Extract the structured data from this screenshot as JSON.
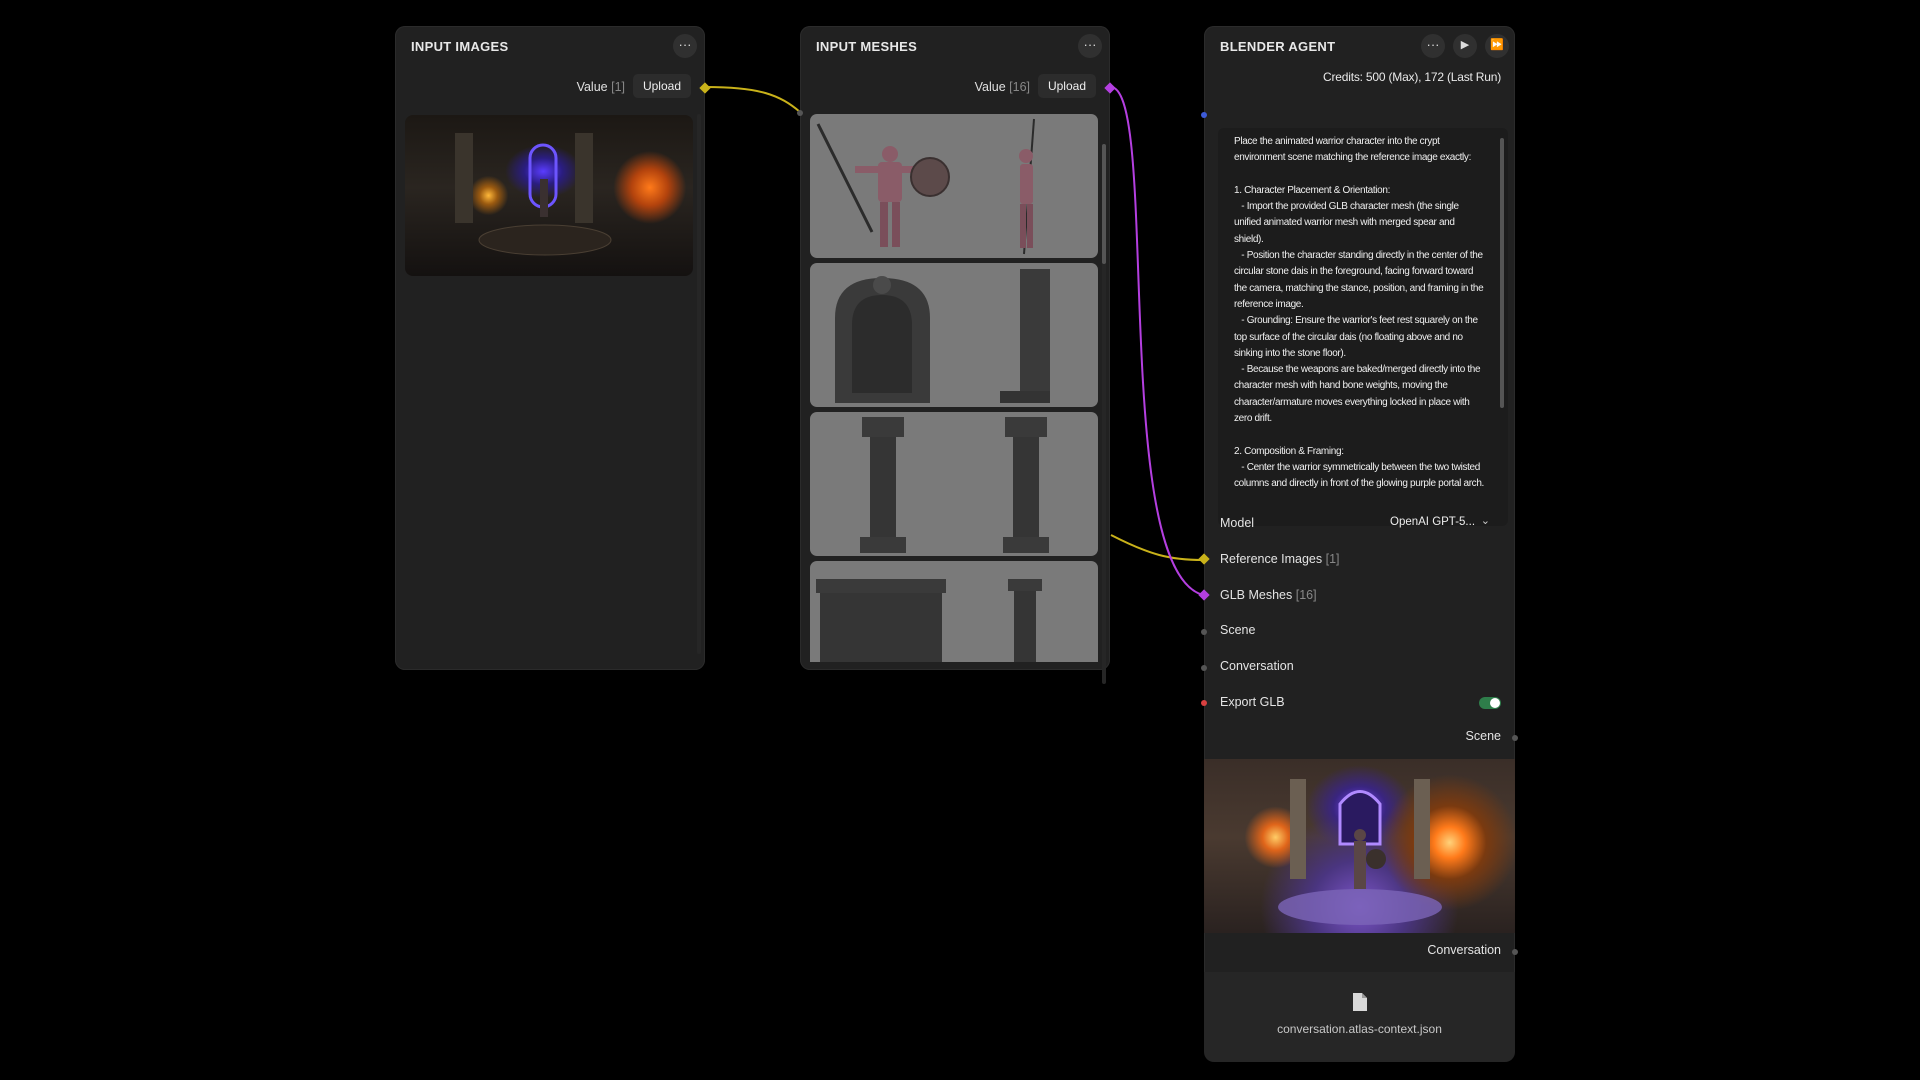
{
  "nodes": {
    "input_images": {
      "title": "INPUT IMAGES",
      "menu_icon": "···",
      "value_label": "Value",
      "value_count": "[1]",
      "upload_label": "Upload"
    },
    "input_meshes": {
      "title": "INPUT MESHES",
      "menu_icon": "···",
      "value_label": "Value",
      "value_count": "[16]",
      "upload_label": "Upload"
    },
    "blender_agent": {
      "title": "BLENDER AGENT",
      "menu_icon": "···",
      "run_icon": "▶",
      "run_all_icon": "⏩",
      "credits": "Credits: 500 (Max), 172 (Last Run)",
      "prompt": "Place the animated warrior character into the crypt environment scene matching the reference image exactly:\n\n1. Character Placement & Orientation:\n   - Import the provided GLB character mesh (the single unified animated warrior mesh with merged spear and shield).\n   - Position the character standing directly in the center of the circular stone dais in the foreground, facing forward toward the camera, matching the stance, position, and framing in the reference image.\n   - Grounding: Ensure the warrior's feet rest squarely on the top surface of the circular dais (no floating above and no sinking into the stone floor).\n   - Because the weapons are baked/merged directly into the character mesh with hand bone weights, moving the character/armature moves everything locked in place with zero drift.\n\n2. Composition & Framing:\n   - Center the warrior symmetrically between the two twisted columns and directly in front of the glowing purple portal arch.",
      "model_label": "Model",
      "model_value": "OpenAI GPT-5...",
      "reference_images_label": "Reference Images",
      "reference_images_count": "[1]",
      "glb_meshes_label": "GLB Meshes",
      "glb_meshes_count": "[16]",
      "scene_label": "Scene",
      "conversation_label": "Conversation",
      "export_glb_label": "Export GLB",
      "export_glb_enabled": true,
      "scene_output_label": "Scene",
      "conversation_output_label": "Conversation",
      "file_icon": "file-icon",
      "file_name": "conversation.atlas-context.json"
    }
  },
  "colors": {
    "image_link": "#c9b21a",
    "mesh_link": "#b43fe0",
    "toggle_on": "#2e7d4a"
  }
}
